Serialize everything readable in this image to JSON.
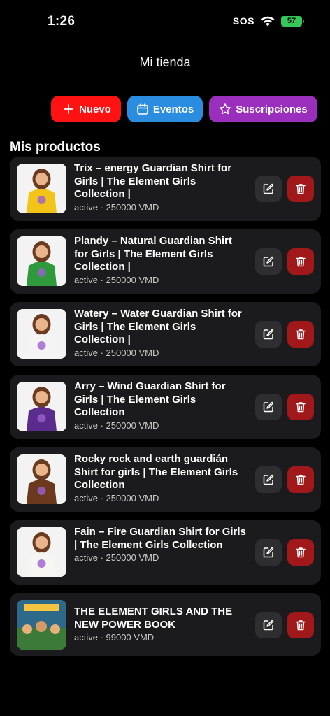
{
  "status": {
    "time": "1:26",
    "sos": "SOS",
    "battery": "57"
  },
  "header": {
    "title": "Mi tienda"
  },
  "actions": {
    "new_label": "Nuevo",
    "events_label": "Eventos",
    "subs_label": "Suscripciones"
  },
  "section": {
    "title": "Mis productos"
  },
  "colors": {
    "new": "#ff1212",
    "events": "#2a8de0",
    "subs": "#9b2fbd",
    "delete": "#a1181b"
  },
  "products": [
    {
      "title": "Trix – energy Guardian Shirt for Girls | The Element Girls Collection |",
      "meta": "active · 250000 VMD",
      "shirt": "#f2c41a"
    },
    {
      "title": "Plandy – Natural Guardian Shirt for Girls | The Element Girls Collection |",
      "meta": "active · 250000 VMD",
      "shirt": "#2e9a3c"
    },
    {
      "title": "Watery – Water Guardian Shirt for Girls | The Element Girls Collection |",
      "meta": "active · 250000 VMD",
      "shirt": "#f4f4f4"
    },
    {
      "title": "Arry – Wind Guardian Shirt for Girls | The Element Girls Collection",
      "meta": "active · 250000 VMD",
      "shirt": "#5a2d8c"
    },
    {
      "title": "Rocky rock and earth guardián Shirt for girls | The Element Girls Collection",
      "meta": "active · 250000 VMD",
      "shirt": "#6b3a1e"
    },
    {
      "title": "Fain – Fire Guardian Shirt for Girls | The Element Girls Collection",
      "meta": "active · 250000 VMD",
      "shirt": "#f7f5f2"
    },
    {
      "title": "THE ELEMENT GIRLS AND THE NEW POWER BOOK",
      "meta": "active · 99000 VMD",
      "shirt": "#3c7a3a"
    }
  ]
}
